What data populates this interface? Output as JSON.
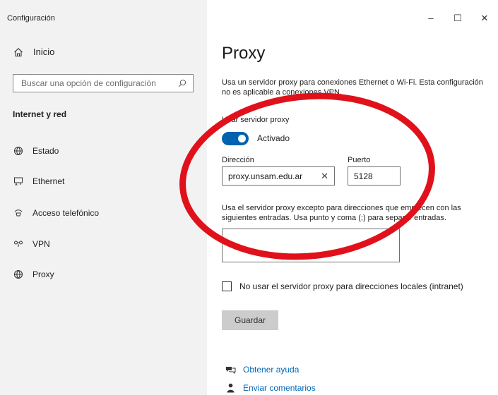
{
  "window": {
    "title": "Configuración",
    "controls": {
      "minimize": "–",
      "maximize": "☐",
      "close": "✕"
    }
  },
  "sidebar": {
    "home_label": "Inicio",
    "search_placeholder": "Buscar una opción de configuración",
    "section_title": "Internet y red",
    "items": [
      {
        "label": "Estado",
        "icon": "globe-status-icon"
      },
      {
        "label": "Ethernet",
        "icon": "ethernet-icon"
      },
      {
        "label": "Acceso telefónico",
        "icon": "dial-up-icon"
      },
      {
        "label": "VPN",
        "icon": "vpn-icon"
      },
      {
        "label": "Proxy",
        "icon": "globe-icon"
      }
    ]
  },
  "main": {
    "title": "Proxy",
    "description": "Usa un servidor proxy para conexiones Ethernet o Wi-Fi. Esta configuración no es aplicable a conexiones VPN.",
    "use_proxy_label": "Usar servidor proxy",
    "toggle_state": "Activado",
    "toggle_on": true,
    "address_label": "Dirección",
    "address_value": "proxy.unsam.edu.ar",
    "port_label": "Puerto",
    "port_value": "5128",
    "exceptions_text": "Usa el servidor proxy excepto para direcciones que empiecen con las siguientes entradas. Usa punto y coma (;) para separar entradas.",
    "exceptions_value": "",
    "local_checkbox_label": "No usar el servidor proxy para direcciones locales (intranet)",
    "local_checkbox_checked": false,
    "save_label": "Guardar",
    "help_links": [
      {
        "label": "Obtener ayuda",
        "icon": "help-chat-icon"
      },
      {
        "label": "Enviar comentarios",
        "icon": "feedback-icon"
      }
    ]
  },
  "colors": {
    "accent": "#0063b1",
    "link": "#0067b8",
    "annotation": "#e0111b",
    "sidebar_bg": "#f2f2f2"
  }
}
